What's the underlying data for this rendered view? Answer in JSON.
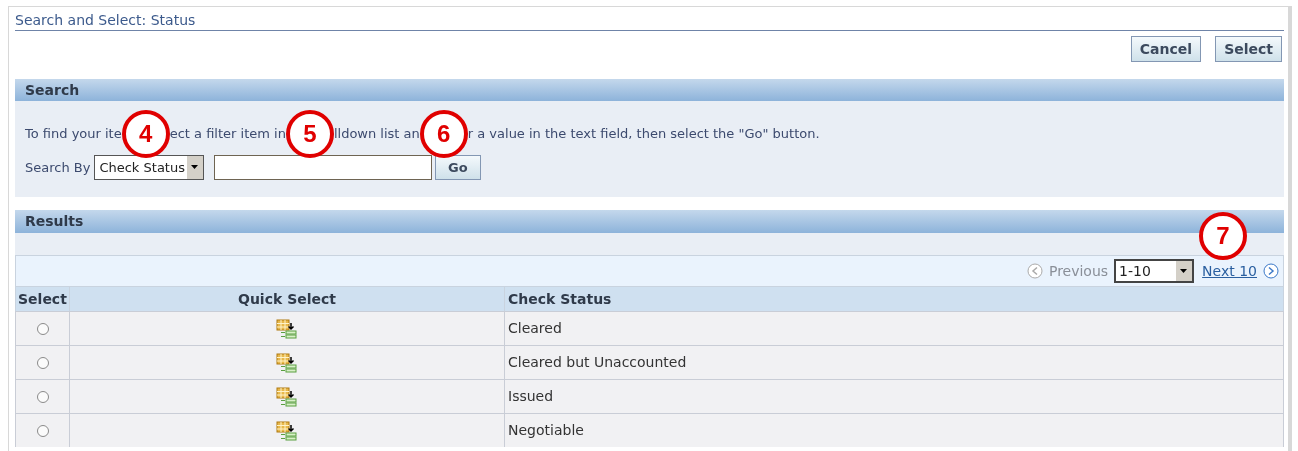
{
  "title": "Search and Select: Status",
  "buttons": [
    {
      "label": "Cancel"
    },
    {
      "label": "Select"
    }
  ],
  "search": {
    "header": "Search",
    "instruction_fragments": [
      {
        "kind": "text",
        "text": "To find your ite"
      },
      {
        "kind": "callout",
        "text": "4"
      },
      {
        "kind": "text",
        "text": "ect a filter item in"
      },
      {
        "kind": "callout",
        "text": "5"
      },
      {
        "kind": "text",
        "text": "lldown list an"
      },
      {
        "kind": "callout",
        "text": "6"
      },
      {
        "kind": "text",
        "text": "r a value in the text field, then select the \"Go\" button."
      }
    ],
    "label": "Search By",
    "dropdown": "Check Status",
    "go": "Go"
  },
  "results": {
    "header": "Results",
    "callout": "7",
    "previous": "Previous",
    "range": "1-10",
    "next": "Next 10",
    "columns": [
      "Select",
      "Quick Select",
      "Check Status"
    ],
    "rows": [
      {
        "selected": false,
        "status": "Cleared"
      },
      {
        "selected": false,
        "status": "Cleared but Unaccounted"
      },
      {
        "selected": false,
        "status": "Issued"
      },
      {
        "selected": false,
        "status": "Negotiable"
      }
    ]
  }
}
